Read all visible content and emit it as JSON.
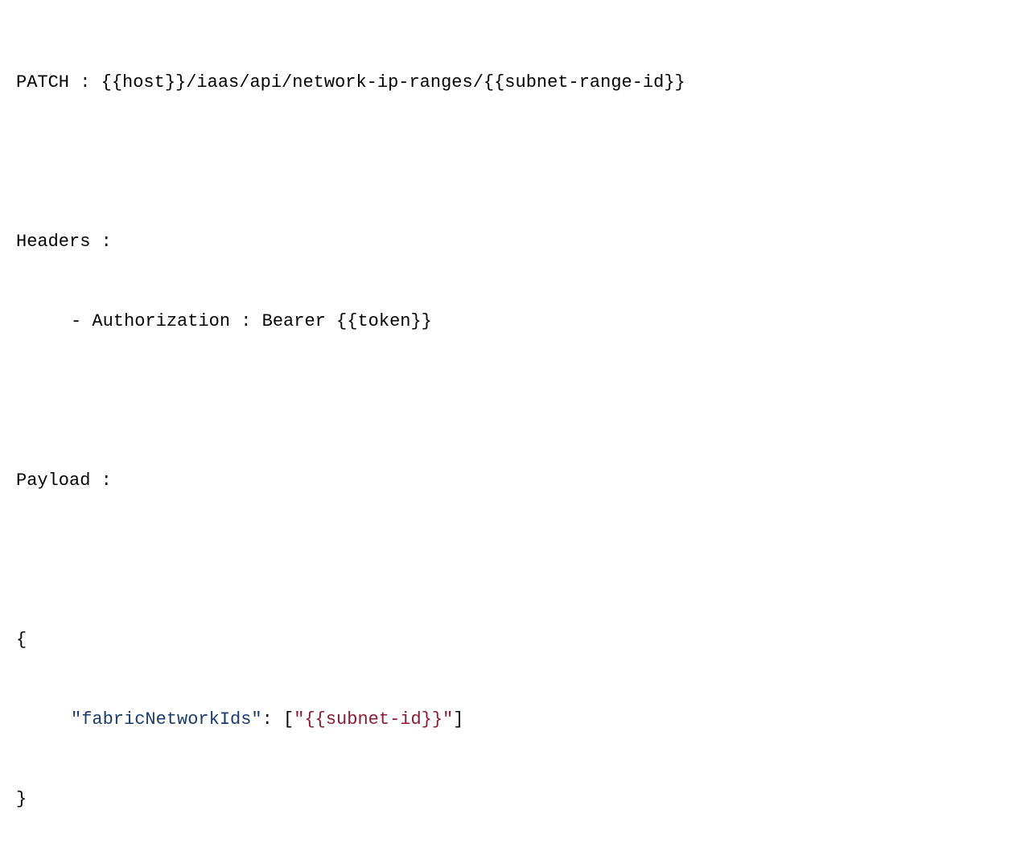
{
  "request": {
    "method_line": "PATCH : {{host}}/iaas/api/network-ip-ranges/{{subnet-range-id}}",
    "headers_label": "Headers :",
    "header_auth": "- Authorization : Bearer {{token}}",
    "payload_label": "Payload :",
    "json_open": "{",
    "json_key": "\"fabricNetworkIds\"",
    "json_colon_open": ": [",
    "json_value": "\"{{subnet-id}}\"",
    "json_close_array": "]",
    "json_close": "}"
  }
}
